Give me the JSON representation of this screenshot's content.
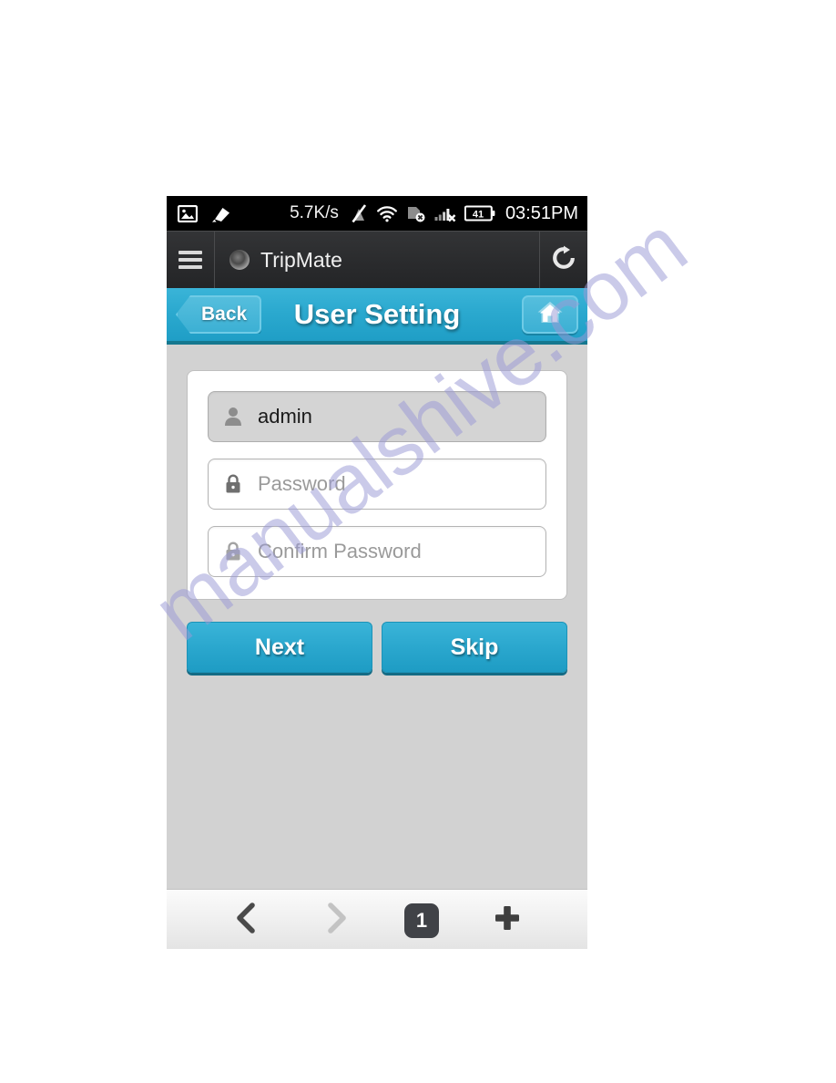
{
  "watermark": {
    "text": "manualshive.com",
    "color": "#9b9ad6"
  },
  "status_bar": {
    "network_speed": "5.7K/s",
    "time": "03:51PM",
    "battery_level": "41",
    "left_icons": [
      "image-icon",
      "screenshot-icon"
    ],
    "right_icons": [
      "mute-icon",
      "wifi-icon",
      "sim-disabled-icon",
      "signal-no-service-icon",
      "battery-icon"
    ]
  },
  "browser": {
    "menu_icon": "hamburger-menu-icon",
    "favicon": "tripmate-favicon",
    "page_title": "TripMate",
    "refresh_icon": "refresh-icon",
    "bottom": {
      "back_icon": "chevron-left-icon",
      "forward_icon": "chevron-right-icon",
      "tab_count": "1",
      "new_tab_icon": "plus-icon"
    }
  },
  "page_header": {
    "back_label": "Back",
    "title": "User Setting",
    "home_icon": "home-icon",
    "accent_color": "#2ba9cf",
    "border_color": "#15788f"
  },
  "form": {
    "fields": [
      {
        "name": "username",
        "icon": "user-icon",
        "value": "admin",
        "placeholder": "",
        "is_placeholder": false,
        "disabled": true
      },
      {
        "name": "password",
        "icon": "lock-icon",
        "value": "",
        "placeholder": "Password",
        "is_placeholder": true,
        "disabled": false
      },
      {
        "name": "confirm-password",
        "icon": "lock-icon",
        "value": "",
        "placeholder": "Confirm Password",
        "is_placeholder": true,
        "disabled": false
      }
    ],
    "buttons": [
      {
        "name": "next",
        "label": "Next"
      },
      {
        "name": "skip",
        "label": "Skip"
      }
    ]
  }
}
